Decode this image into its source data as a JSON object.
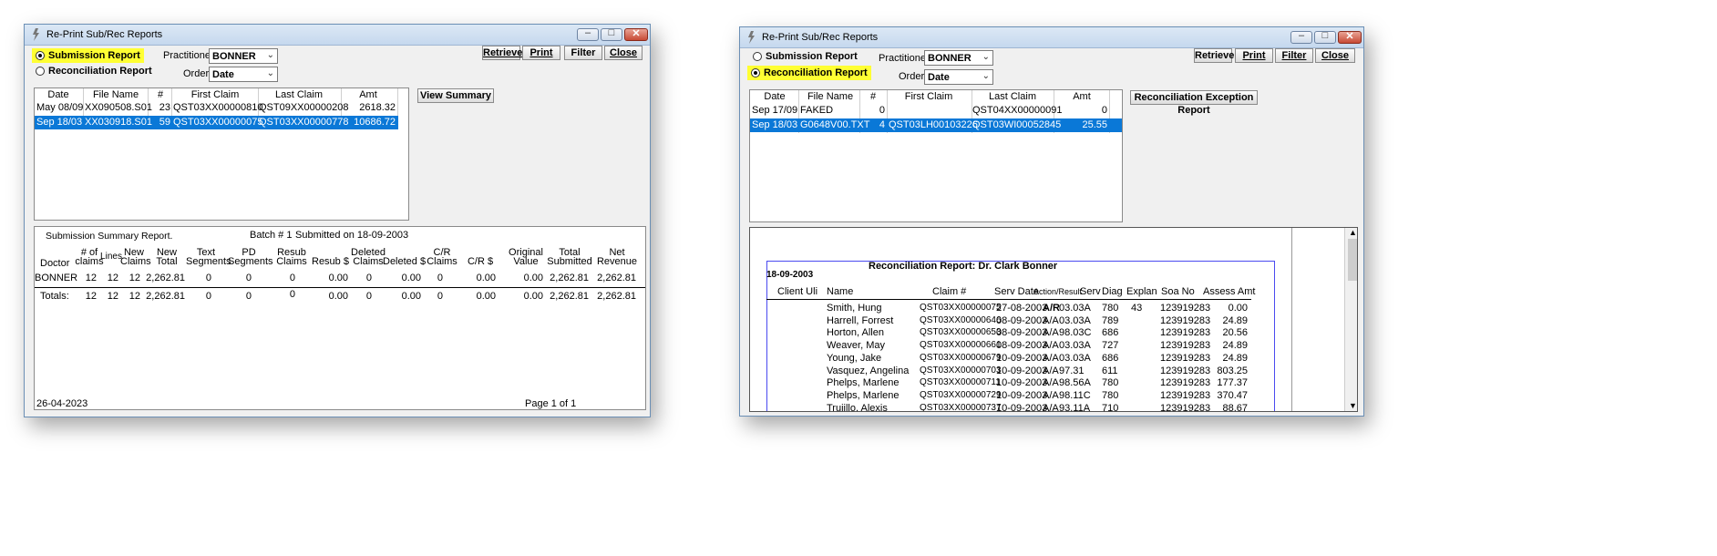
{
  "left": {
    "title": "Re-Print Sub/Rec Reports",
    "radio_submission": "Submission Report",
    "radio_reconciliation": "Reconciliation Report",
    "practitioner_label": "Practitioner:",
    "practitioner_value": "BONNER",
    "order_label": "Order:",
    "order_value": "Date",
    "btn_retrieve": "Retrieve",
    "btn_print": "Print",
    "btn_filter": "Filter",
    "btn_close": "Close",
    "btn_view_summary": "View Summary",
    "grid_headers": [
      "Date",
      "File Name",
      "#",
      "First Claim",
      "Last Claim",
      "Amt"
    ],
    "grid_rows": [
      {
        "date": "May 08/09",
        "file": "XX090508.S01",
        "num": "23",
        "first": "QST03XX00000810",
        "last": "QST09XX00000208",
        "amt": "2618.32",
        "selected": false
      },
      {
        "date": "Sep 18/03",
        "file": "XX030918.S01",
        "num": "59",
        "first": "QST03XX00000075",
        "last": "QST03XX00000778",
        "amt": "10686.72",
        "selected": true
      }
    ],
    "report": {
      "title": "Submission Summary Report.",
      "batch": "Batch # 1",
      "submitted": "Submitted on 18-09-2003",
      "headers": {
        "doctor": "Doctor",
        "num_claims_1": "# of",
        "num_claims_2": "claims",
        "lines": "Lines",
        "new_claims_1": "New",
        "new_claims_2": "Claims",
        "new_total_1": "New",
        "new_total_2": "Total",
        "text_seg_1": "Text",
        "text_seg_2": "Segments",
        "pd_seg_1": "PD",
        "pd_seg_2": "Segments",
        "resub_claims_1": "Resub",
        "resub_claims_2": "Claims",
        "resub_dollar": "Resub $",
        "deleted_claims_1": "Deleted",
        "deleted_claims_2": "Claims",
        "deleted_dollar": "Deleted $",
        "cr_claims_1": "C/R",
        "cr_claims_2": "Claims",
        "cr_dollar": "C/R $",
        "original_value_1": "Original",
        "original_value_2": "Value",
        "total_submitted_1": "Total",
        "total_submitted_2": "Submitted",
        "net_revenue_1": "Net",
        "net_revenue_2": "Revenue"
      },
      "row": [
        "BONNER",
        "12",
        "12",
        "12",
        "2,262.81",
        "0",
        "0",
        "0",
        "0.00",
        "0",
        "0.00",
        "0",
        "0.00",
        "0.00",
        "2,262.81",
        "2,262.81"
      ],
      "totals": [
        "Totals:",
        "12",
        "12",
        "12",
        "2,262.81",
        "0",
        "0",
        "0",
        "0.00",
        "0",
        "0.00",
        "0",
        "0.00",
        "0.00",
        "2,262.81",
        "2,262.81"
      ],
      "footer_date": "26-04-2023",
      "footer_page": "Page 1 of 1"
    }
  },
  "right": {
    "title": "Re-Print Sub/Rec Reports",
    "radio_submission": "Submission Report",
    "radio_reconciliation": "Reconciliation Report",
    "practitioner_label": "Practitioner:",
    "practitioner_value": "BONNER",
    "order_label": "Order:",
    "order_value": "Date",
    "btn_retrieve": "Retrieve",
    "btn_print": "Print",
    "btn_filter": "Filter",
    "btn_close": "Close",
    "btn_exception": "Reconciliation Exception Report",
    "grid_headers": [
      "Date",
      "File Name",
      "#",
      "First Claim",
      "Last Claim",
      "Amt"
    ],
    "grid_rows": [
      {
        "date": "Sep 17/09",
        "file": "FAKED",
        "num": "0",
        "first": "",
        "last": "QST04XX00000091",
        "amt": "0",
        "selected": false
      },
      {
        "date": "Sep 18/03",
        "file": "G0648V00.TXT",
        "num": "4",
        "first": "QST03LH00103226",
        "last": "QST03WI00052845",
        "amt": "25.55",
        "selected": true
      }
    ],
    "report": {
      "title": "Reconciliation Report: Dr. Clark Bonner",
      "date": "18-09-2003",
      "headers": {
        "client_uli": "Client Uli",
        "name": "Name",
        "claim": "Claim #",
        "serv_date": "Serv Date",
        "action_result": "Action/Result",
        "serv": "Serv",
        "diag": "Diag",
        "explan": "Explan",
        "soa_no": "Soa No",
        "assess_amt": "Assess Amt"
      },
      "rows": [
        {
          "name": "Smith, Hung",
          "claim": "QST03XX00000075",
          "date": "27-08-2003",
          "ar": "A/R",
          "serv": "03.03A",
          "diag": "780",
          "explan": "43",
          "soa": "123919283",
          "amt": "0.00"
        },
        {
          "name": "Harrell, Forrest",
          "claim": "QST03XX00000646",
          "date": "08-09-2003",
          "ar": "A/A",
          "serv": "03.03A",
          "diag": "789",
          "explan": "",
          "soa": "123919283",
          "amt": "24.89"
        },
        {
          "name": "Horton, Allen",
          "claim": "QST03XX00000653",
          "date": "08-09-2003",
          "ar": "A/A",
          "serv": "98.03C",
          "diag": "686",
          "explan": "",
          "soa": "123919283",
          "amt": "20.56"
        },
        {
          "name": "Weaver, May",
          "claim": "QST03XX00000661",
          "date": "08-09-2003",
          "ar": "A/A",
          "serv": "03.03A",
          "diag": "727",
          "explan": "",
          "soa": "123919283",
          "amt": "24.89"
        },
        {
          "name": "Young, Jake",
          "claim": "QST03XX00000679",
          "date": "10-09-2003",
          "ar": "A/A",
          "serv": "03.03A",
          "diag": "686",
          "explan": "",
          "soa": "123919283",
          "amt": "24.89"
        },
        {
          "name": "Vasquez, Angelina",
          "claim": "QST03XX00000703",
          "date": "10-09-2003",
          "ar": "A/A",
          "serv": "97.31",
          "diag": "611",
          "explan": "",
          "soa": "123919283",
          "amt": "803.25"
        },
        {
          "name": "Phelps, Marlene",
          "claim": "QST03XX00000711",
          "date": "10-09-2003",
          "ar": "A/A",
          "serv": "98.56A",
          "diag": "780",
          "explan": "",
          "soa": "123919283",
          "amt": "177.37"
        },
        {
          "name": "Phelps, Marlene",
          "claim": "QST03XX00000729",
          "date": "10-09-2003",
          "ar": "A/A",
          "serv": "98.11C",
          "diag": "780",
          "explan": "",
          "soa": "123919283",
          "amt": "370.47"
        },
        {
          "name": "Trujillo, Alexis",
          "claim": "QST03XX00000737",
          "date": "10-09-2003",
          "ar": "A/A",
          "serv": "93.11A",
          "diag": "710",
          "explan": "",
          "soa": "123919283",
          "amt": "88.67"
        }
      ]
    }
  }
}
